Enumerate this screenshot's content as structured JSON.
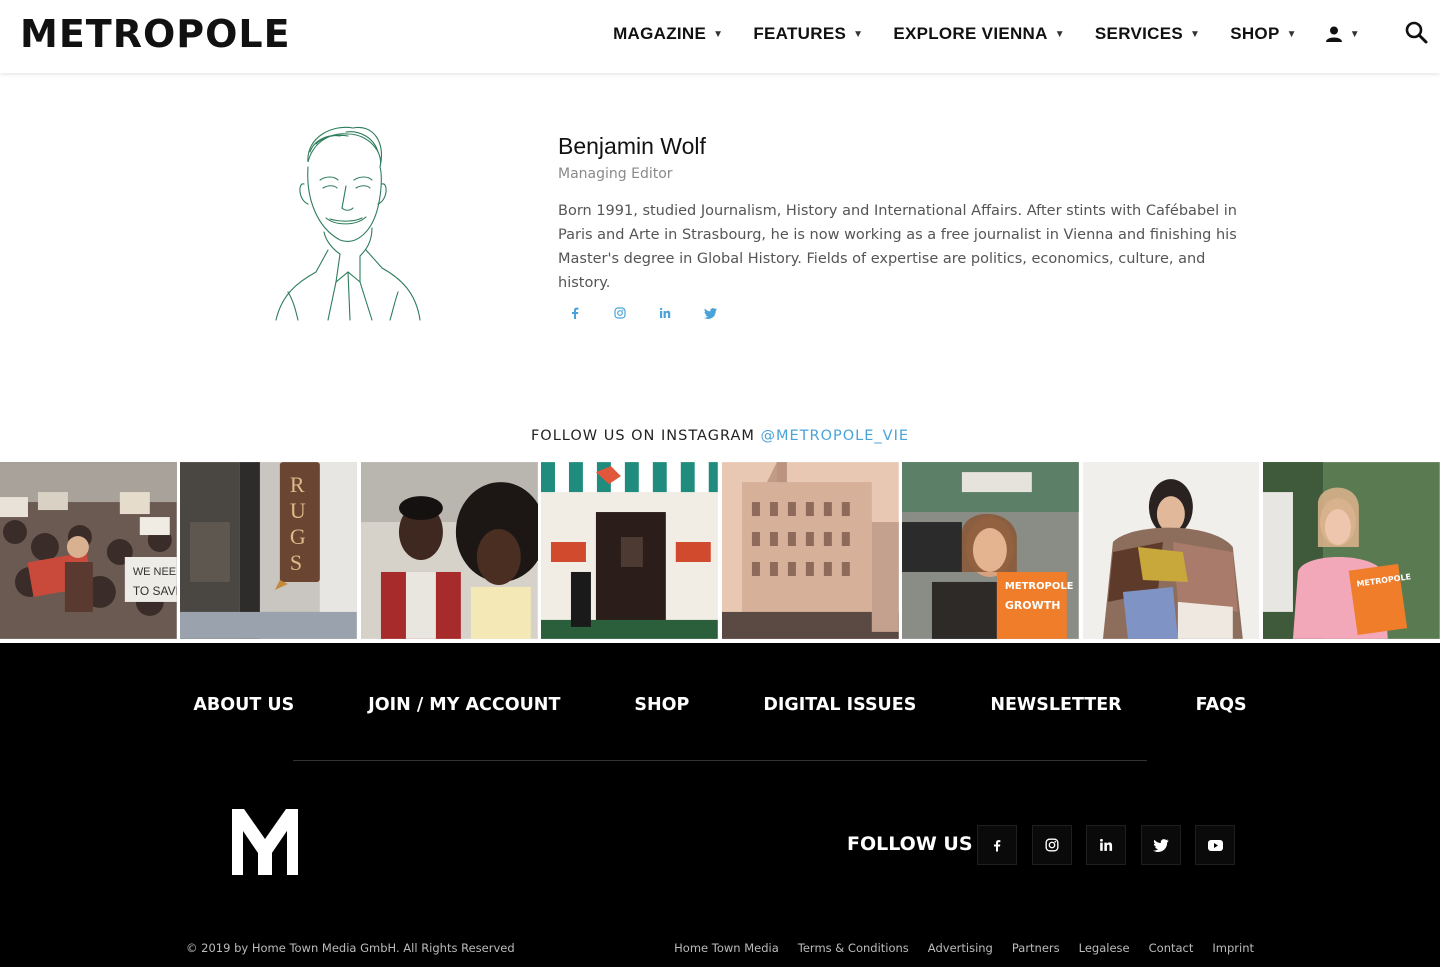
{
  "header": {
    "logo": "METROPOLE",
    "nav": [
      {
        "label": "MAGAZINE"
      },
      {
        "label": "FEATURES"
      },
      {
        "label": "EXPLORE VIENNA"
      },
      {
        "label": "SERVICES"
      },
      {
        "label": "SHOP"
      }
    ],
    "icons": {
      "user": "user-icon",
      "search": "search-icon"
    }
  },
  "author": {
    "name": "Benjamin Wolf",
    "role": "Managing Editor",
    "bio": "Born 1991, studied Journalism, History and International Affairs. After stints with Cafébabel in Paris and Arte in Strasbourg, he is now working as a free journalist in Vienna and finishing his Master's degree in Global History. Fields of expertise are politics, economics, culture, and history.",
    "social": [
      "facebook-icon",
      "instagram-icon",
      "linkedin-icon",
      "twitter-icon"
    ]
  },
  "instagram": {
    "heading": "FOLLOW US ON INSTAGRAM",
    "handle": "@METROPOLE_VIE",
    "tiles": [
      "climate-protest-photo",
      "rugs-storefront-photo",
      "couple-portrait-photo",
      "cafe-entrance-photo",
      "vienna-building-photo",
      "reader-magazine-photo",
      "woman-fabrics-photo",
      "woman-pink-sweater-photo"
    ]
  },
  "footer": {
    "nav": [
      "ABOUT US",
      "JOIN / MY ACCOUNT",
      "SHOP",
      "DIGITAL ISSUES",
      "NEWSLETTER",
      "FAQS"
    ],
    "follow_label": "FOLLOW US",
    "social": [
      "facebook-icon",
      "instagram-icon",
      "linkedin-icon",
      "twitter-icon",
      "youtube-icon"
    ],
    "copyright": "© 2019 by Home Town Media GmbH. All Rights Reserved",
    "links": [
      "Home Town Media",
      "Terms & Conditions",
      "Advertising",
      "Partners",
      "Legalese",
      "Contact",
      "Imprint"
    ]
  },
  "colors": {
    "accent": "#4aa3d8",
    "portrait_line": "#2e7d5b",
    "footer_bg": "#000000"
  }
}
